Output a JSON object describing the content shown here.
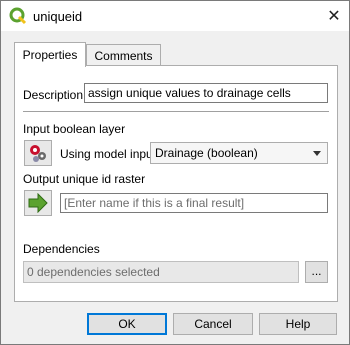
{
  "window": {
    "title": "uniqueid",
    "close_label": "✕"
  },
  "tabs": [
    {
      "label": "Properties"
    },
    {
      "label": "Comments"
    }
  ],
  "properties": {
    "description_label": "Description",
    "description_value": "assign unique values to drainage cells",
    "input_section_label": "Input boolean layer",
    "using_model_input_label": "Using model input",
    "input_combo_value": "Drainage (boolean)",
    "output_section_label": "Output unique id raster",
    "output_placeholder": "[Enter name if this is a final result]",
    "dependencies_label": "Dependencies",
    "dependencies_value": "0 dependencies selected",
    "dependencies_button": "..."
  },
  "buttons": {
    "ok": "OK",
    "cancel": "Cancel",
    "help": "Help"
  },
  "colors": {
    "qgis_green": "#5ba22f",
    "accent_blue": "#0078d7"
  },
  "icons": [
    "qgis-logo-icon",
    "close-icon",
    "model-input-gears-icon",
    "output-arrow-icon",
    "dropdown-arrow-icon"
  ]
}
